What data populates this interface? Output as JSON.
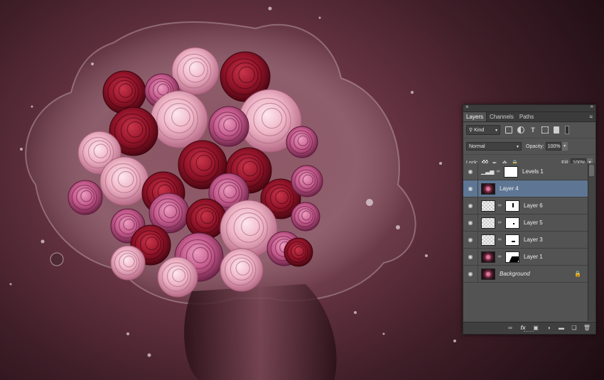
{
  "panel": {
    "close_glyph": "×",
    "collapse_glyph": "»",
    "tabs": [
      {
        "label": "Layers",
        "active": true
      },
      {
        "label": "Channels",
        "active": false
      },
      {
        "label": "Paths",
        "active": false
      }
    ],
    "menu_glyph": "≡",
    "filter": {
      "label": "Kind",
      "icon": "search-icon"
    },
    "blend_mode": "Normal",
    "opacity_label": "Opacity:",
    "opacity_value": "100%",
    "lock_label": "Lock:",
    "fill_label": "Fill:",
    "fill_value": "100%",
    "layers": [
      {
        "name": "Levels 1",
        "type": "adjustment",
        "selected": false
      },
      {
        "name": "Layer 4",
        "type": "image",
        "selected": true
      },
      {
        "name": "Layer 6",
        "type": "masked",
        "selected": false
      },
      {
        "name": "Layer 5",
        "type": "masked",
        "selected": false
      },
      {
        "name": "Layer 3",
        "type": "masked",
        "selected": false
      },
      {
        "name": "Layer 1",
        "type": "masked",
        "selected": false
      },
      {
        "name": "Background",
        "type": "background",
        "selected": false,
        "locked": true
      }
    ],
    "bottom_icons": [
      "link-icon",
      "fx-icon",
      "mask-icon",
      "adjustment-icon",
      "folder-icon",
      "new-layer-icon",
      "trash-icon"
    ]
  },
  "colors": {
    "background_dark": "#1d0c12",
    "background_mid": "#6a3544",
    "rose_red": "#9b1528",
    "rose_pink": "#e79ab0",
    "panel_bg": "#535353",
    "selection": "#5e7693"
  }
}
